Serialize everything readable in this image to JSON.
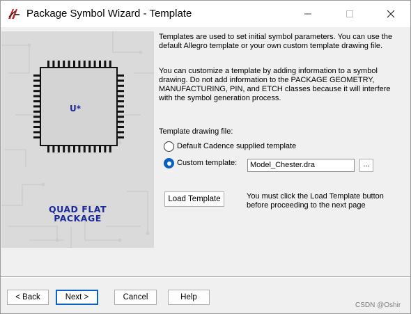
{
  "window": {
    "title": "Package Symbol Wizard - Template",
    "minimize_icon": "minimize-icon",
    "maximize_icon": "maximize-icon",
    "close_icon": "close-icon"
  },
  "illustration": {
    "chip_label": "U*",
    "package_line1": "QUAD FLAT",
    "package_line2": "PACKAGE"
  },
  "intro": {
    "line1": "Templates are used to set initial symbol parameters. You can use the",
    "line2": "default Allegro template or your own custom template drawing file."
  },
  "notice": {
    "line1": "You can customize a template by adding information to a symbol",
    "line2": "drawing. Do not add information to the PACKAGE GEOMETRY,",
    "line3": "MANUFACTURING, PIN, and ETCH classes because it will interfere",
    "line4": "with the symbol generation process."
  },
  "template": {
    "section_label": "Template drawing file:",
    "option_default": "Default Cadence supplied template",
    "option_custom": "Custom template:",
    "selected": "custom",
    "file_value": "Model_Chester.dra",
    "browse_label": "..."
  },
  "load": {
    "button_label": "Load Template",
    "hint_line1": "You must click the Load Template button",
    "hint_line2": "before proceeding to the next page"
  },
  "footer": {
    "back_label": "< Back",
    "next_label": "Next >",
    "cancel_label": "Cancel",
    "help_label": "Help"
  },
  "watermark": "CSDN @Oshir",
  "colors": {
    "accent": "#0a5fc0",
    "package_text": "#1a2a9c"
  }
}
